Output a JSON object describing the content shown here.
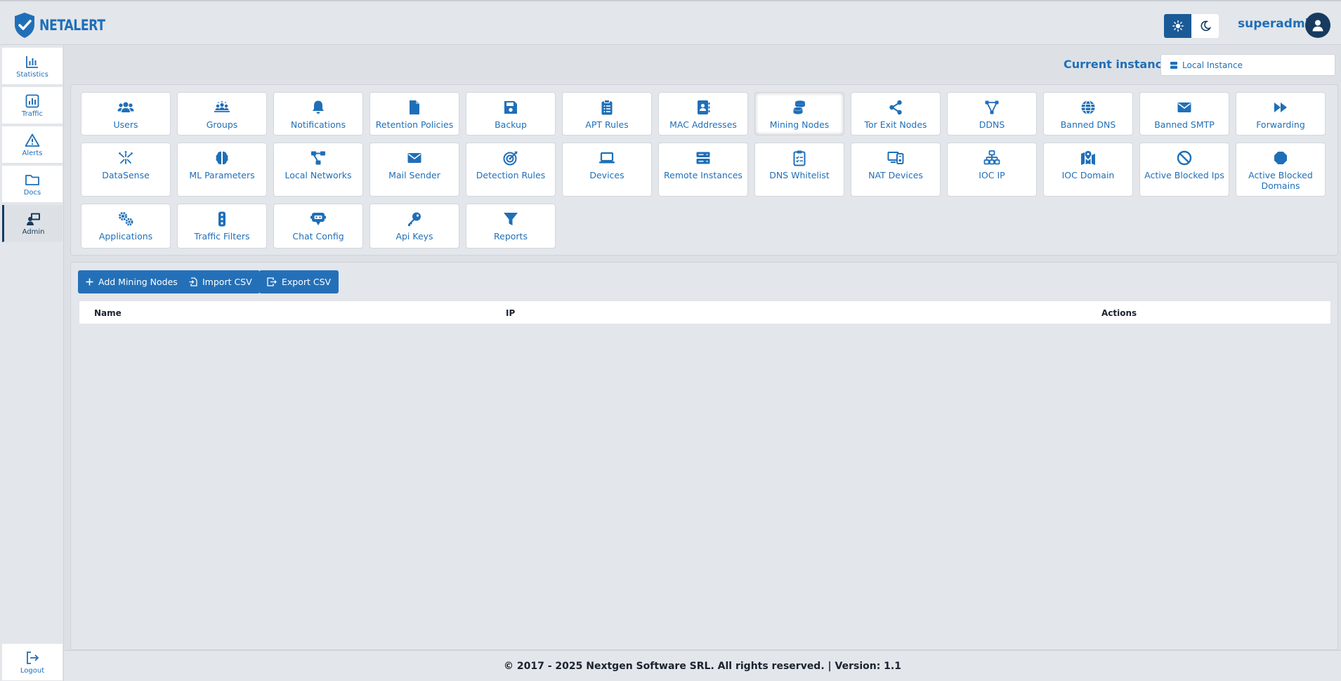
{
  "app": {
    "logo_text": "NETALERT",
    "brand_color": "#1f6fb8"
  },
  "header": {
    "username": "superadmin",
    "theme_light_icon": "sun-icon",
    "theme_dark_icon": "moon-icon"
  },
  "sidebar": {
    "items": [
      {
        "label": "Statistics",
        "icon": "bar-chart-icon"
      },
      {
        "label": "Traffic",
        "icon": "chart-box-icon"
      },
      {
        "label": "Alerts",
        "icon": "warning-triangle-icon"
      },
      {
        "label": "Docs",
        "icon": "folder-icon"
      },
      {
        "label": "Admin",
        "icon": "admin-screen-icon"
      }
    ],
    "logout": {
      "label": "Logout",
      "icon": "logout-icon"
    }
  },
  "instance": {
    "label": "Current instance:",
    "value": "Local Instance"
  },
  "admin_tiles": [
    {
      "label": "Users",
      "icon": "users-icon"
    },
    {
      "label": "Groups",
      "icon": "groups-icon"
    },
    {
      "label": "Notifications",
      "icon": "bell-icon"
    },
    {
      "label": "Retention Policies",
      "icon": "file-icon"
    },
    {
      "label": "Backup",
      "icon": "floppy-icon"
    },
    {
      "label": "APT Rules",
      "icon": "clipboard-list-icon"
    },
    {
      "label": "MAC Addresses",
      "icon": "address-book-icon"
    },
    {
      "label": "Mining Nodes",
      "icon": "coins-icon"
    },
    {
      "label": "Tor Exit Nodes",
      "icon": "share-nodes-icon"
    },
    {
      "label": "DDNS",
      "icon": "vector-icon"
    },
    {
      "label": "Banned DNS",
      "icon": "globe-icon"
    },
    {
      "label": "Banned SMTP",
      "icon": "envelope-icon"
    },
    {
      "label": "Forwarding",
      "icon": "fast-forward-icon"
    },
    {
      "label": "DataSense",
      "icon": "sparkle-icon"
    },
    {
      "label": "ML Parameters",
      "icon": "brain-icon"
    },
    {
      "label": "Local Networks",
      "icon": "network-icon"
    },
    {
      "label": "Mail Sender",
      "icon": "mail-icon"
    },
    {
      "label": "Detection Rules",
      "icon": "target-icon"
    },
    {
      "label": "Devices",
      "icon": "laptop-icon"
    },
    {
      "label": "Remote Instances",
      "icon": "server-icon"
    },
    {
      "label": "DNS Whitelist",
      "icon": "clipboard-check-icon"
    },
    {
      "label": "NAT Devices",
      "icon": "desktop-device-icon"
    },
    {
      "label": "IOC IP",
      "icon": "sitemap-icon"
    },
    {
      "label": "IOC Domain",
      "icon": "map-pin-icon"
    },
    {
      "label": "Active Blocked Ips",
      "icon": "ban-icon"
    },
    {
      "label": "Active Blocked Domains",
      "icon": "stop-octagon-icon"
    },
    {
      "label": "Applications",
      "icon": "gears-icon"
    },
    {
      "label": "Traffic Filters",
      "icon": "traffic-light-icon"
    },
    {
      "label": "Chat Config",
      "icon": "chat-robot-icon"
    },
    {
      "label": "Api Keys",
      "icon": "key-icon"
    },
    {
      "label": "Reports",
      "icon": "filter-icon"
    }
  ],
  "toolbar": {
    "add_label": "Add Mining Nodes",
    "import_label": "Import CSV",
    "export_label": "Export CSV"
  },
  "table": {
    "columns": [
      "Name",
      "IP",
      "Actions"
    ]
  },
  "footer": {
    "text": "© 2017 - 2025 Nextgen Software SRL. All rights reserved. | Version: 1.1"
  }
}
